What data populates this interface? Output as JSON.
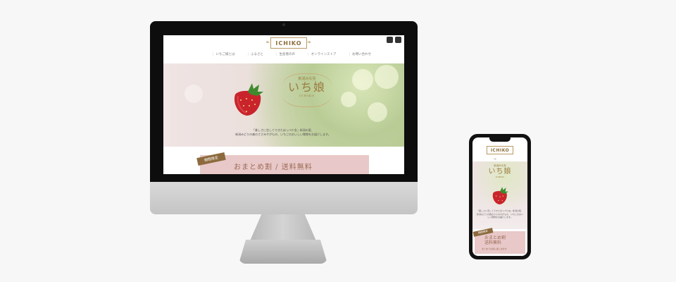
{
  "desktop": {
    "logo_text": "ICHIKO",
    "nav_items": [
      "いちご娘とは",
      "ふるさと",
      "生産者の声",
      "オンラインストア",
      "お問い合わせ"
    ],
    "hero": {
      "subtitle": "新潟みな島",
      "title": "いち娘",
      "title_en": "ICHIKO",
      "caption_line1": "「美しさに恋してできたほっぺ少女」新潟の夏、",
      "caption_line2": "新潟みどりの森のささみやがもの、いちごのおいしい贈物をお届けします。"
    },
    "banner": {
      "ribbon": "期間限定",
      "text": "おまとめ割 / 送料無料"
    }
  },
  "mobile": {
    "logo_text": "ICHIKO",
    "menu_icon": "≡",
    "hero": {
      "subtitle": "新潟みな島",
      "title": "いち娘",
      "title_en": "ICHIKO",
      "caption": "「美しさに恋してできたほっぺ少女」新潟の夏、新潟みどりの森のささみやがもの、いちごのおいしい贈物をお届けします。"
    },
    "banner": {
      "ribbon": "期間限定",
      "line1": "おまとめ割",
      "line2": "送料無料",
      "sub": "まとめてお得に楽しめます"
    }
  },
  "colors": {
    "gold": "#9b7a3f",
    "banner_pink": "#e8c8c8",
    "strawberry_red": "#c9242c"
  }
}
